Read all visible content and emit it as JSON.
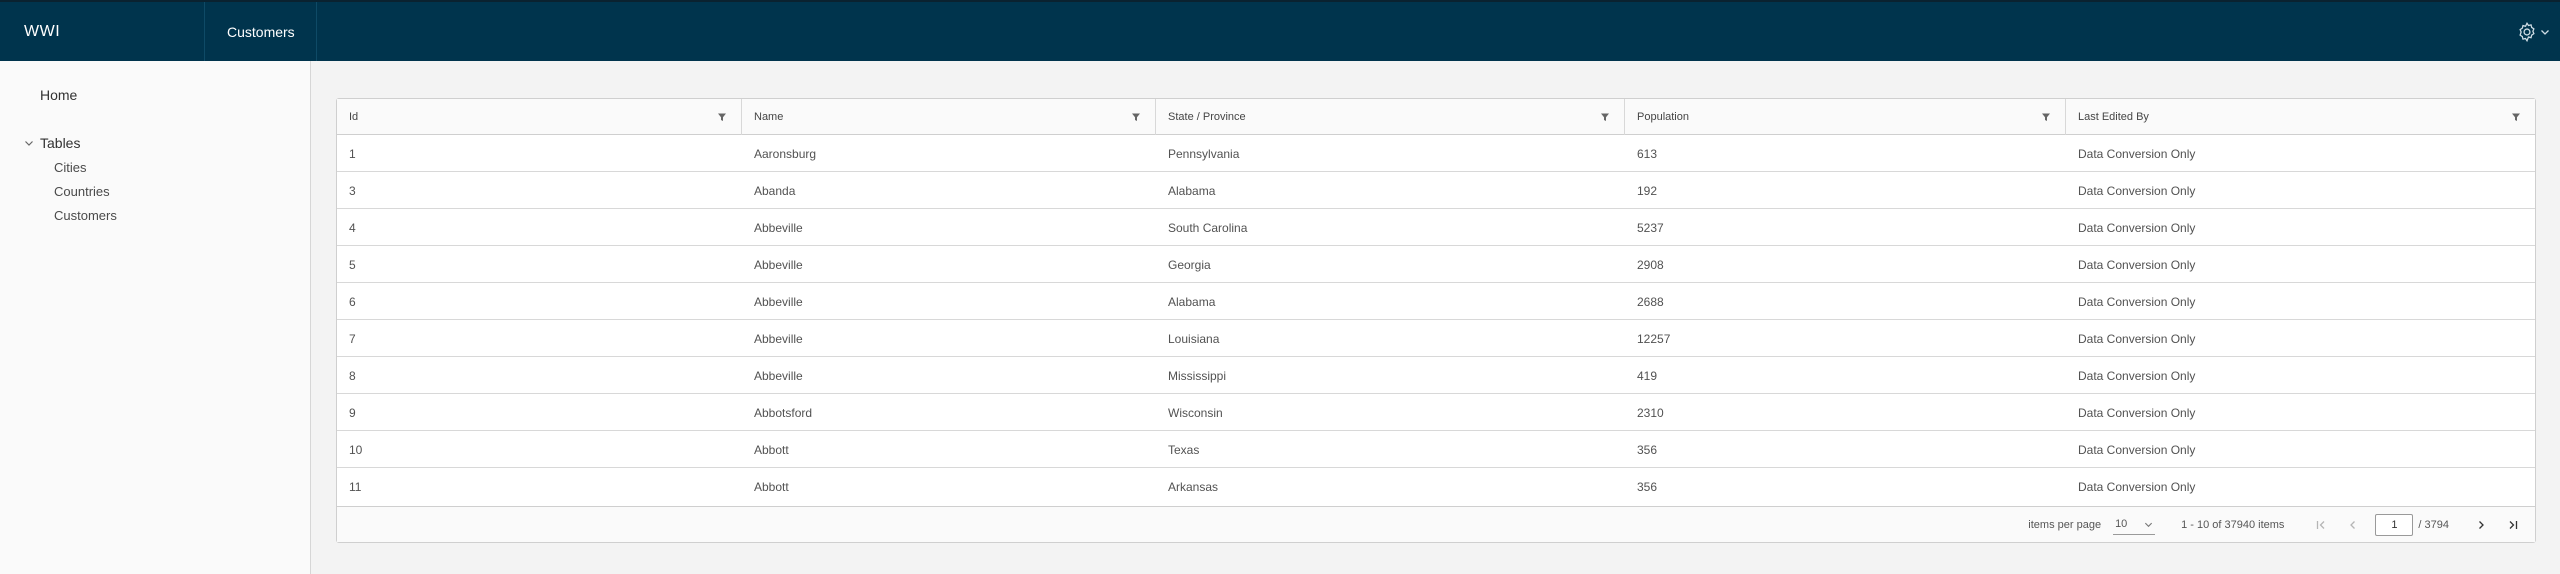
{
  "header": {
    "brand": "WWI",
    "tab": "Customers"
  },
  "sidebar": {
    "home": "Home",
    "tables": "Tables",
    "items": [
      "Cities",
      "Countries",
      "Customers"
    ]
  },
  "grid": {
    "columns": [
      "Id",
      "Name",
      "State / Province",
      "Population",
      "Last Edited By"
    ],
    "rows": [
      [
        "1",
        "Aaronsburg",
        "Pennsylvania",
        "613",
        "Data Conversion Only"
      ],
      [
        "3",
        "Abanda",
        "Alabama",
        "192",
        "Data Conversion Only"
      ],
      [
        "4",
        "Abbeville",
        "South Carolina",
        "5237",
        "Data Conversion Only"
      ],
      [
        "5",
        "Abbeville",
        "Georgia",
        "2908",
        "Data Conversion Only"
      ],
      [
        "6",
        "Abbeville",
        "Alabama",
        "2688",
        "Data Conversion Only"
      ],
      [
        "7",
        "Abbeville",
        "Louisiana",
        "12257",
        "Data Conversion Only"
      ],
      [
        "8",
        "Abbeville",
        "Mississippi",
        "419",
        "Data Conversion Only"
      ],
      [
        "9",
        "Abbotsford",
        "Wisconsin",
        "2310",
        "Data Conversion Only"
      ],
      [
        "10",
        "Abbott",
        "Texas",
        "356",
        "Data Conversion Only"
      ],
      [
        "11",
        "Abbott",
        "Arkansas",
        "356",
        "Data Conversion Only"
      ]
    ]
  },
  "pagination": {
    "items_per_page_label": "items per page",
    "items_per_page": "10",
    "range": "1 - 10 of 37940 items",
    "current_page": "1",
    "total_pages": "/ 3794"
  },
  "colors": {
    "header_bg": "#00344d",
    "page_bg": "#f3f3f3"
  }
}
